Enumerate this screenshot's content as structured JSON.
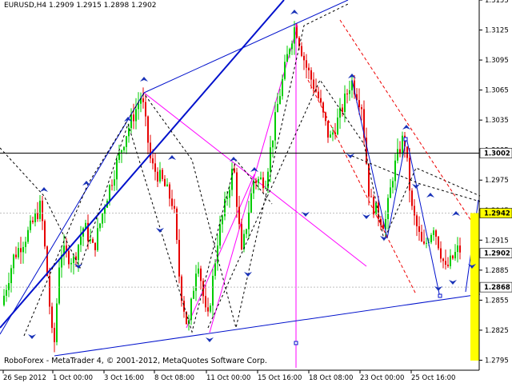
{
  "title": "EURUSD,H4  1.2909 1.2915 1.2898 1.2902",
  "footer": "RoboForex - MetaTrader 4, © 2001-2012, MetaQuotes Software Corp.",
  "colors": {
    "bull": "#00cc00",
    "bear": "#e60000",
    "up_arrow": "#1a33b8",
    "trendline": "#0011cc",
    "projection": "#ff00ff",
    "channel": "#ee0000",
    "current_price_label": "#000000",
    "target_box": "#ffff00"
  },
  "chart_data": {
    "type": "candlestick",
    "symbol": "EURUSD",
    "timeframe": "H4",
    "ohlc_last": {
      "open": 1.2909,
      "high": 1.2915,
      "low": 1.2898,
      "close": 1.2902
    },
    "ylim": [
      1.2785,
      1.3155
    ],
    "y_ticks": [
      "1.3155",
      "1.3125",
      "1.3095",
      "1.3065",
      "1.3035",
      "1.3005",
      "1.2975",
      "1.2945",
      "1.2915",
      "1.2885",
      "1.2855",
      "1.2825",
      "1.2795"
    ],
    "x_ticks": [
      "26 Sep 2012",
      "1 Oct 00:00",
      "3 Oct 16:00",
      "8 Oct 08:00",
      "11 Oct 00:00",
      "15 Oct 16:00",
      "18 Oct 08:00",
      "23 Oct 00:00",
      "25 Oct 16:00"
    ],
    "price_labels": [
      {
        "price": 1.3002,
        "label": "1.3002",
        "style": "white"
      },
      {
        "price": 1.2942,
        "label": "1.2942",
        "style": "yellow"
      },
      {
        "price": 1.2902,
        "label": "1.2902",
        "style": "white"
      },
      {
        "price": 1.2868,
        "label": "1.2868",
        "style": "white"
      }
    ],
    "horizontal_line": 1.3002,
    "grid": false
  }
}
